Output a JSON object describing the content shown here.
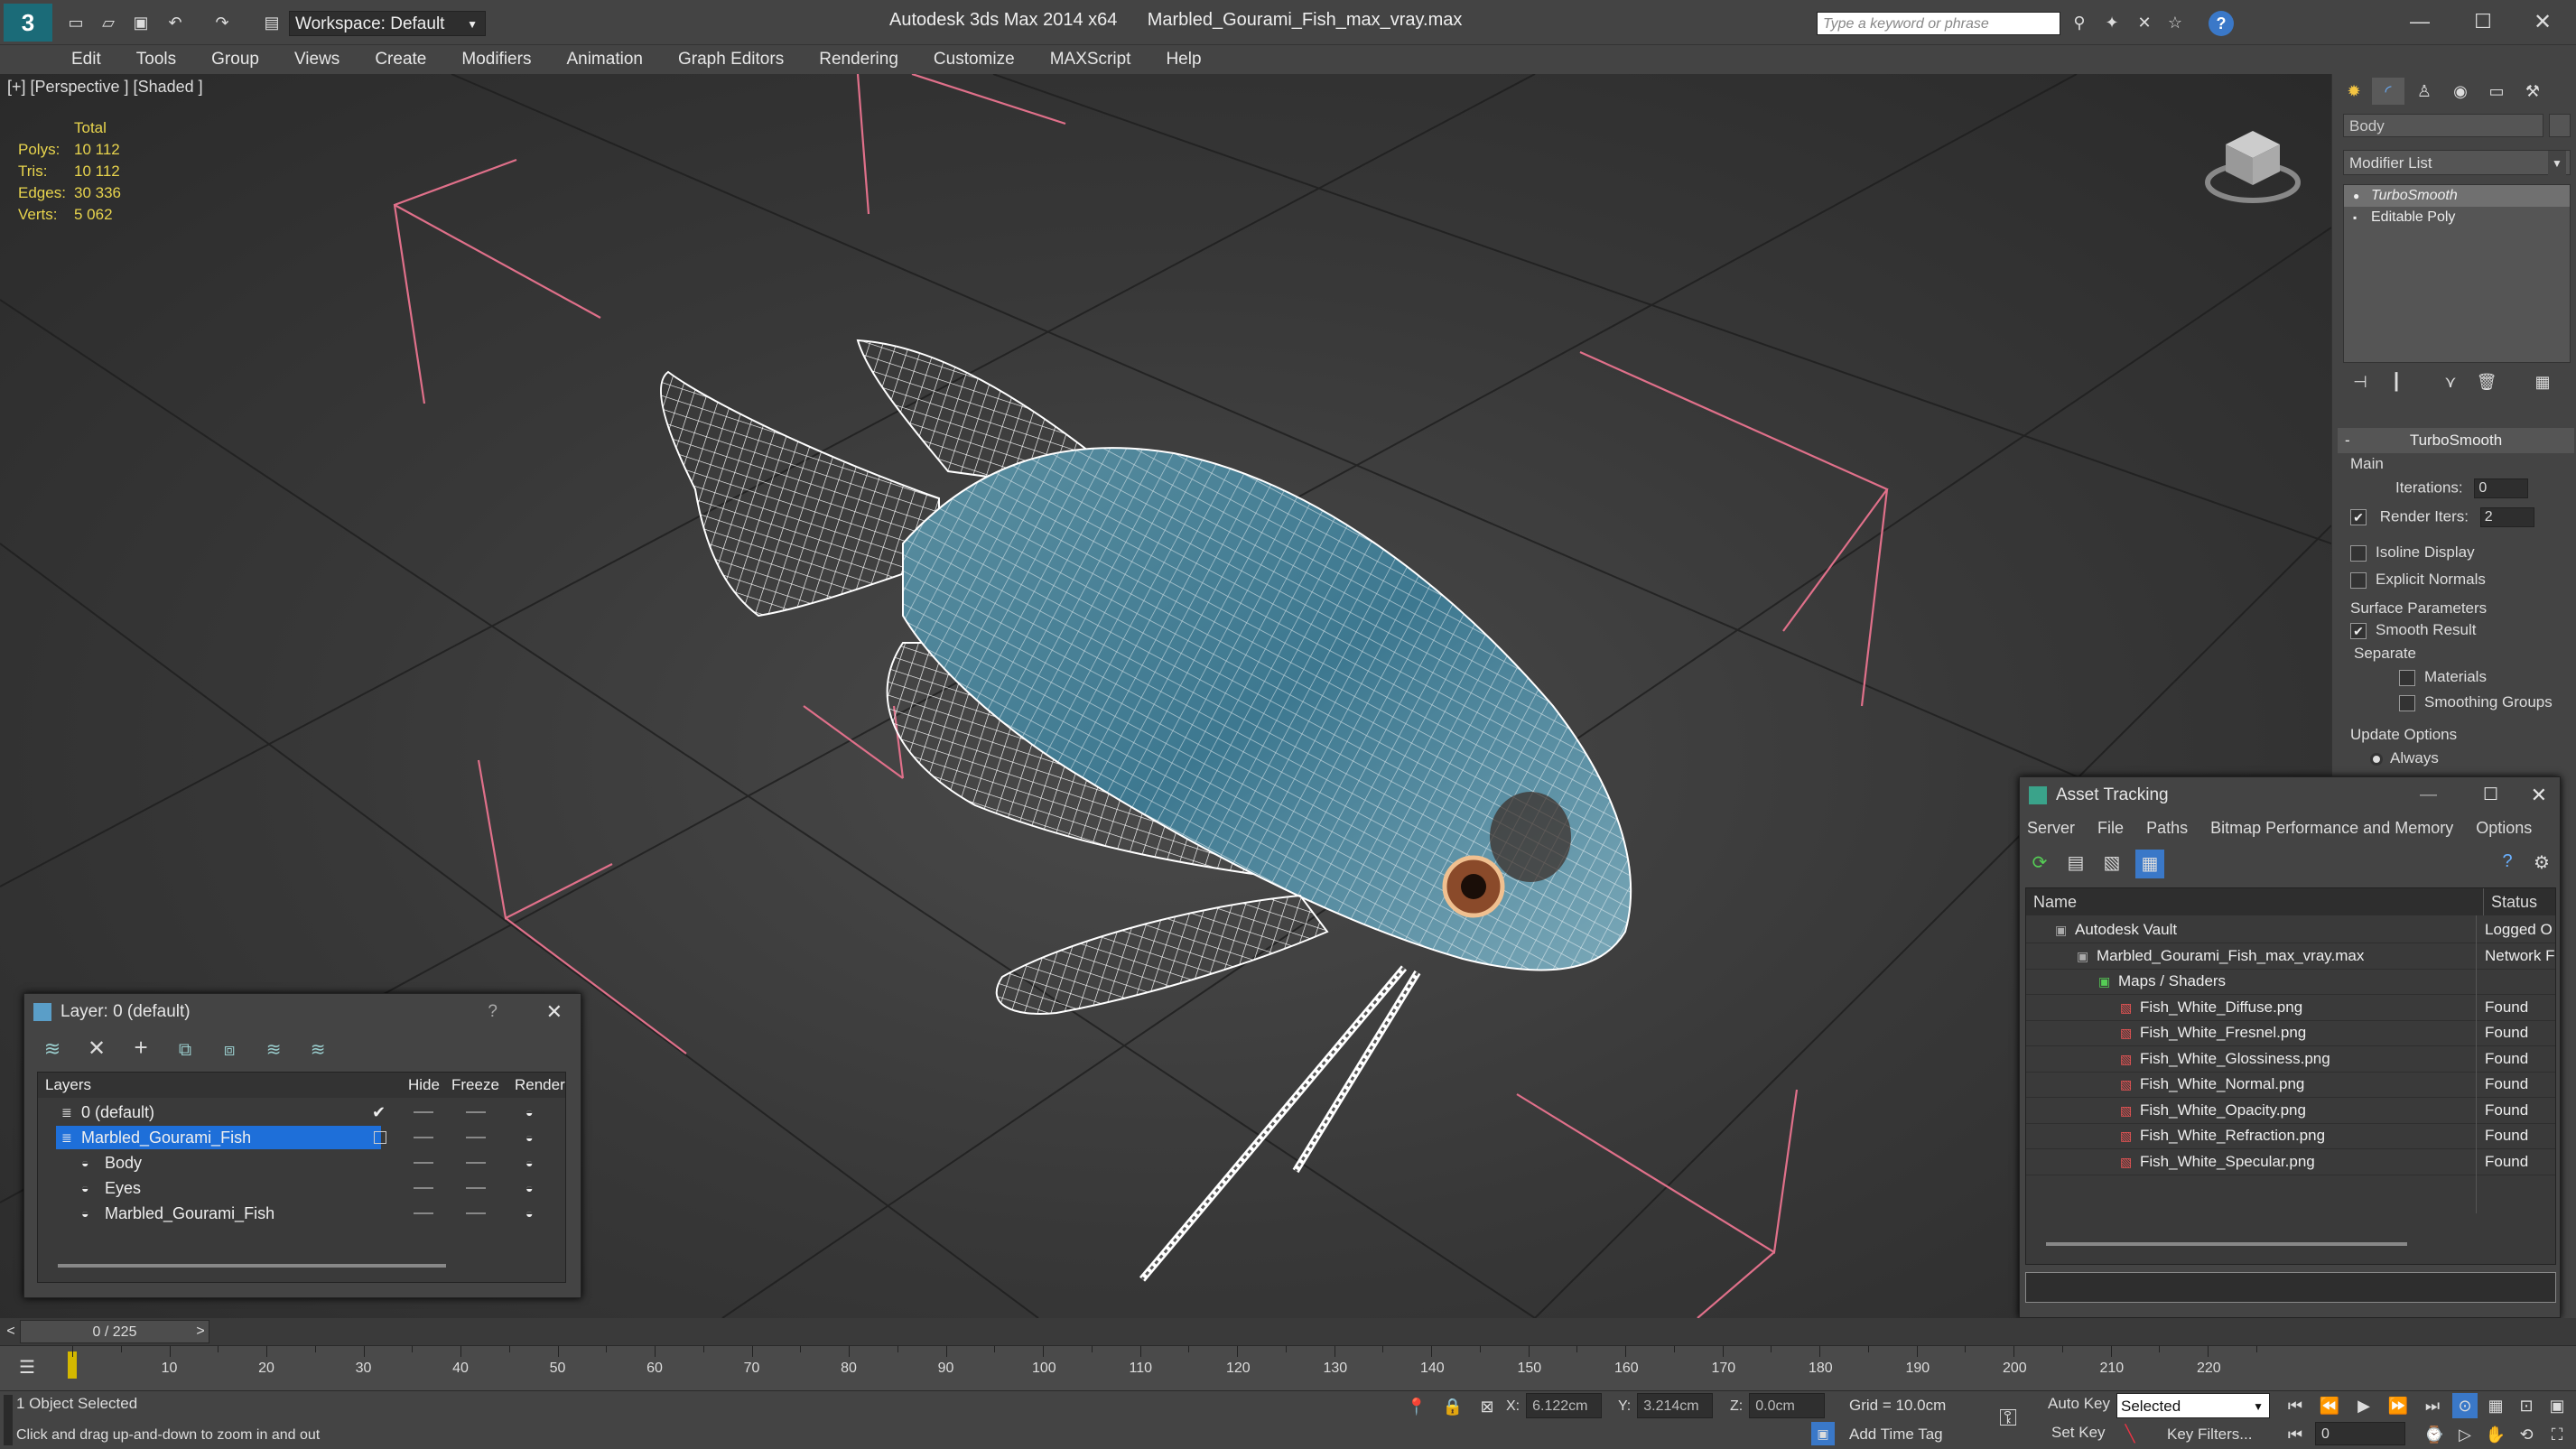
{
  "app": {
    "title": "Autodesk 3ds Max  2014 x64",
    "file": "Marbled_Gourami_Fish_max_vray.max",
    "workspace": "Workspace: Default",
    "search_placeholder": "Type a keyword or phrase"
  },
  "menu": [
    "Edit",
    "Tools",
    "Group",
    "Views",
    "Create",
    "Modifiers",
    "Animation",
    "Graph Editors",
    "Rendering",
    "Customize",
    "MAXScript",
    "Help"
  ],
  "viewport": {
    "label": "[+] [Perspective ] [Shaded ]",
    "stats": {
      "header": "Total",
      "rows": [
        {
          "label": "Polys:",
          "value": "10 112"
        },
        {
          "label": "Tris:",
          "value": "10 112"
        },
        {
          "label": "Edges:",
          "value": "30 336"
        },
        {
          "label": "Verts:",
          "value": "5 062"
        }
      ]
    }
  },
  "command_panel": {
    "object_name": "Body",
    "modifier_list": "Modifier List",
    "stack": [
      "TurboSmooth",
      "Editable Poly"
    ],
    "turbosmooth": {
      "title": "TurboSmooth",
      "main": "Main",
      "iterations_label": "Iterations:",
      "iterations": "0",
      "render_iters_label": "Render Iters:",
      "render_iters": "2",
      "isoline": "Isoline Display",
      "explicit_normals": "Explicit Normals",
      "surface_params": "Surface Parameters",
      "smooth_result": "Smooth Result",
      "separate": "Separate",
      "materials": "Materials",
      "smoothing_groups": "Smoothing Groups",
      "update_options": "Update Options",
      "always": "Always"
    }
  },
  "layer_dialog": {
    "title": "Layer: 0 (default)",
    "help": "?",
    "columns": [
      "Layers",
      "Hide",
      "Freeze",
      "Render"
    ],
    "rows": [
      {
        "name": "0 (default)",
        "indent": 1,
        "selected": false
      },
      {
        "name": "Marbled_Gourami_Fish",
        "indent": 1,
        "selected": true
      },
      {
        "name": "Body",
        "indent": 2,
        "selected": false
      },
      {
        "name": "Eyes",
        "indent": 2,
        "selected": false
      },
      {
        "name": "Marbled_Gourami_Fish",
        "indent": 2,
        "selected": false
      }
    ]
  },
  "asset_tracking": {
    "title": "Asset Tracking",
    "menu": [
      "Server",
      "File",
      "Paths",
      "Bitmap Performance and Memory",
      "Options"
    ],
    "columns": [
      "Name",
      "Status"
    ],
    "rows": [
      {
        "name": "Autodesk Vault",
        "status": "Logged O",
        "indent": 1
      },
      {
        "name": "Marbled_Gourami_Fish_max_vray.max",
        "status": "Network F",
        "indent": 2
      },
      {
        "name": "Maps / Shaders",
        "status": "",
        "indent": 3
      },
      {
        "name": "Fish_White_Diffuse.png",
        "status": "Found",
        "indent": 4
      },
      {
        "name": "Fish_White_Fresnel.png",
        "status": "Found",
        "indent": 4
      },
      {
        "name": "Fish_White_Glossiness.png",
        "status": "Found",
        "indent": 4
      },
      {
        "name": "Fish_White_Normal.png",
        "status": "Found",
        "indent": 4
      },
      {
        "name": "Fish_White_Opacity.png",
        "status": "Found",
        "indent": 4
      },
      {
        "name": "Fish_White_Refraction.png",
        "status": "Found",
        "indent": 4
      },
      {
        "name": "Fish_White_Specular.png",
        "status": "Found",
        "indent": 4
      }
    ]
  },
  "timeline": {
    "position": "0 / 225",
    "ticks": [
      "10",
      "20",
      "30",
      "40",
      "50",
      "60",
      "70",
      "80",
      "90",
      "100",
      "110",
      "120",
      "130",
      "140",
      "150",
      "160",
      "170",
      "180",
      "190",
      "200",
      "210",
      "220"
    ]
  },
  "status": {
    "selected": "1 Object Selected",
    "hint": "Click and drag up-and-down to zoom in and out",
    "x_label": "X:",
    "x": "6.122cm",
    "y_label": "Y:",
    "y": "3.214cm",
    "z_label": "Z:",
    "z": "0.0cm",
    "grid": "Grid = 10.0cm",
    "add_time_tag": "Add Time Tag",
    "auto_key": "Auto Key",
    "set_key": "Set Key",
    "key_mode": "Selected",
    "key_filters": "Key Filters...",
    "frame": "0"
  },
  "colors": {
    "accent": "#1e6fd9",
    "stats_yellow": "#e8d44d",
    "bbox_pink": "#e0708a"
  }
}
